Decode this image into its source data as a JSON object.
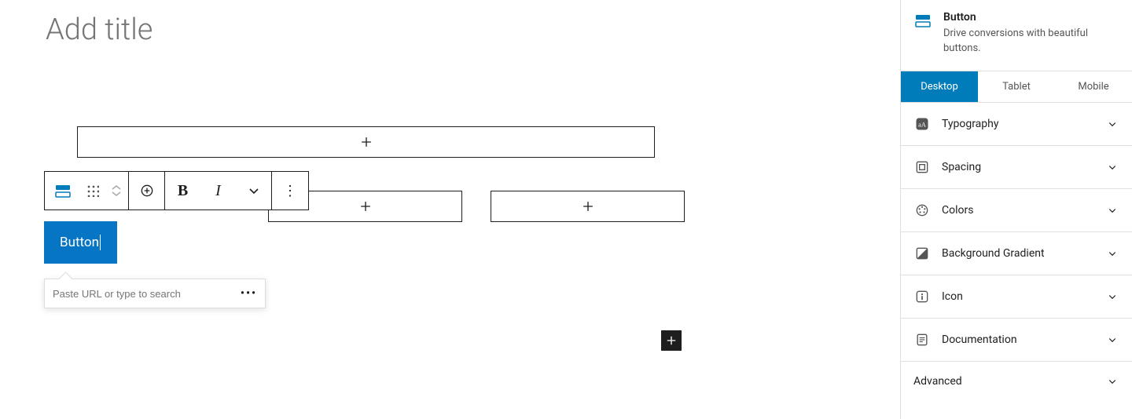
{
  "editor": {
    "title_placeholder": "Add title",
    "button_block_text": "Button",
    "url_popover": {
      "placeholder": "Paste URL or type to search"
    }
  },
  "toolbar": {
    "block_type": "button-block-icon",
    "drag": "drag-handle",
    "movers": "movers",
    "add": "add-block",
    "bold": "B",
    "italic": "I",
    "dropdown": "more-text-controls",
    "more": "block-options"
  },
  "sidebar": {
    "block_card": {
      "title": "Button",
      "description": "Drive conversions with beautiful buttons."
    },
    "device_tabs": {
      "desktop": "Desktop",
      "tablet": "Tablet",
      "mobile": "Mobile"
    },
    "panels": {
      "typography": "Typography",
      "spacing": "Spacing",
      "colors": "Colors",
      "background_gradient": "Background Gradient",
      "icon": "Icon",
      "documentation": "Documentation",
      "advanced": "Advanced"
    }
  }
}
